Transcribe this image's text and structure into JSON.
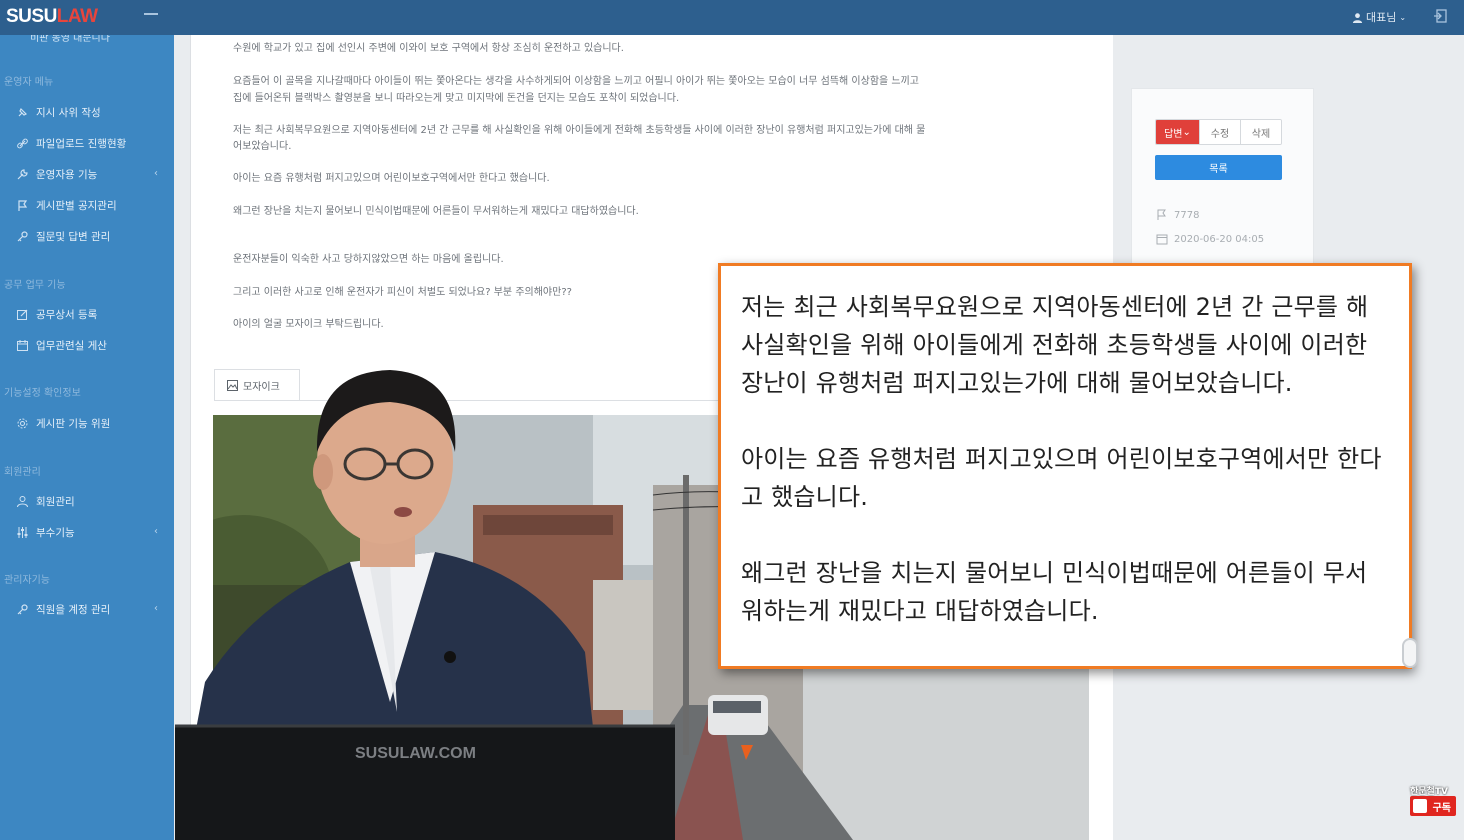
{
  "topbar": {
    "logo_part1": "SUSU",
    "logo_part2": "LAW",
    "user_label": "대표님"
  },
  "sidebar": {
    "cut_label": "비판 동영 대문니다",
    "sections": [
      {
        "title": "운영자 메뉴",
        "items": [
          {
            "label": "지시 사위 작성",
            "icon": "pin-icon",
            "chevron": false
          },
          {
            "label": "파일업로드 진행현황",
            "icon": "link-icon",
            "chevron": false
          },
          {
            "label": "운영자용 기능",
            "icon": "wrench-icon",
            "chevron": true
          },
          {
            "label": "게시판별 공지관리",
            "icon": "flag-icon",
            "chevron": false
          },
          {
            "label": "질문및 답변 관리",
            "icon": "key-icon",
            "chevron": false
          }
        ]
      },
      {
        "title": "공무 업무 기능",
        "items": [
          {
            "label": "공무상서 등록",
            "icon": "edit-icon",
            "chevron": false
          },
          {
            "label": "업무관련실 게산",
            "icon": "calendar-icon",
            "chevron": false
          }
        ]
      },
      {
        "title": "기능설정 확인정보",
        "items": [
          {
            "label": "게시판 기능 위원",
            "icon": "gear-icon",
            "chevron": false
          }
        ]
      },
      {
        "title": "회원관리",
        "items": [
          {
            "label": "회원관리",
            "icon": "user-icon",
            "chevron": false
          },
          {
            "label": "부수기능",
            "icon": "sliders-icon",
            "chevron": true
          }
        ]
      },
      {
        "title": "관리자기능",
        "items": [
          {
            "label": "직원을 계정 관리",
            "icon": "key-icon",
            "chevron": true
          }
        ]
      }
    ]
  },
  "post": {
    "lines": [
      "수원에 학교가 있고 집에 선인시 주변에 이와이 보호 구역에서 항상 조심히 운전하고 있습니다.",
      "요즘들어 이 골목을 지나갈때마다 아이들이 뛰는 쫓아온다는 생각을 사수하게되어 이상함을 느끼고 어필니 아이가 뛰는 쫓아오는 모습이 너무 섬뜩해 이상함을 느끼고",
      "집에 들어온뒤 블랙박스 촬영분을 보니 따라오는게 맞고 미지막에 돈건을 던지는 모습도 포착이 되었습니다.",
      "저는 최근 사회복무요원으로 지역아동센터에 2년 간 근무를 해 사실확인을 위해 아이들에게 전화해 초등학생들 사이에 이러한 장난이 유행처럼 퍼지고있는가에 대해 물",
      "어보았습니다.",
      "아이는 요즘 유행처럼 퍼지고있으며 어린이보호구역에서만 한다고 했습니다.",
      "왜그런 장난을 치는지 물어보니 민식이법때문에 어른들이 무서워하는게 재밌다고 대답하였습니다.",
      "운전자분들이 익숙한 사고 당하지않았으면 하는 마음에 올립니다.",
      "그리고 이러한 사고로 인해 운전자가 피신이 처벌도 되었나요? 부분 주의해야만??",
      "아이의 얼굴 모자이크 부탁드립니다."
    ],
    "attach_tab_label": "모자이크"
  },
  "side_panel": {
    "answer_label": "답변",
    "edit_label": "수정",
    "delete_label": "삭제",
    "list_label": "목록",
    "views": "7778",
    "date": "2020-06-20 04:05"
  },
  "video": {
    "laptop_brand": "SUSULAW.COM"
  },
  "callout": {
    "paragraphs": [
      "저는 최근 사회복무요원으로 지역아동센터에 2년 간 근무를 해 사실확인을 위해 아이들에게 전화해 초등학생들 사이에 이러한 장난이 유행처럼 퍼지고있는가에 대해 물어보았습니다.",
      "아이는 요즘 유행처럼 퍼지고있으며 어린이보호구역에서만 한다고 했습니다.",
      "왜그런 장난을 치는지 물어보니 민식이법때문에 어른들이 무서워하는게 재밌다고 대답하였습니다."
    ]
  },
  "watermark": {
    "channel_name": "한문철TV",
    "subscribe_label": "구독"
  },
  "colors": {
    "topbar": "#2d5f8e",
    "sidebar": "#3d87c2",
    "callout_border": "#f07b23",
    "answer_button": "#e0403a",
    "list_button": "#2d8be0"
  }
}
